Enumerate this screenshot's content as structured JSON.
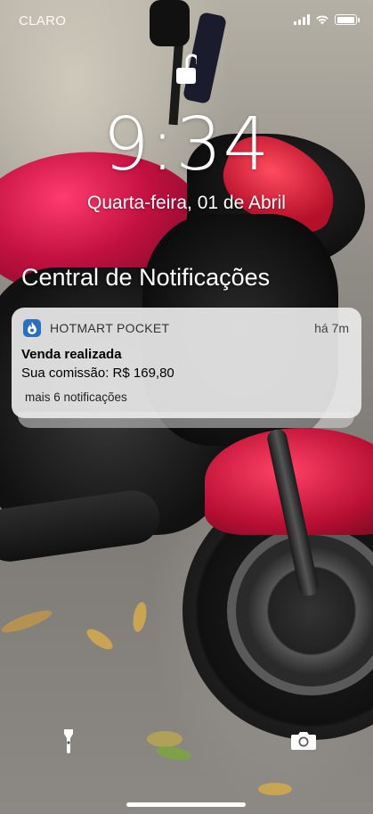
{
  "status_bar": {
    "carrier": "CLARO",
    "signal_icon": "cellular-signal-icon",
    "wifi_icon": "wifi-icon",
    "battery_icon": "battery-icon",
    "battery_level": 0.95
  },
  "lock_screen": {
    "lock_icon": "unlocked-padlock-icon",
    "time": "9:34",
    "date": "Quarta-feira, 01 de Abril",
    "notification_center_title": "Central de Notificações"
  },
  "notification": {
    "app_icon": "hotmart-flame-icon",
    "app_icon_color": "#2b6fc4",
    "app_name": "HOTMART POCKET",
    "time": "há 7m",
    "title": "Venda realizada",
    "body": "Sua comissão: R$ 169,80",
    "more": "mais 6 notificações"
  },
  "controls": {
    "flashlight_icon": "flashlight-icon",
    "camera_icon": "camera-icon"
  }
}
